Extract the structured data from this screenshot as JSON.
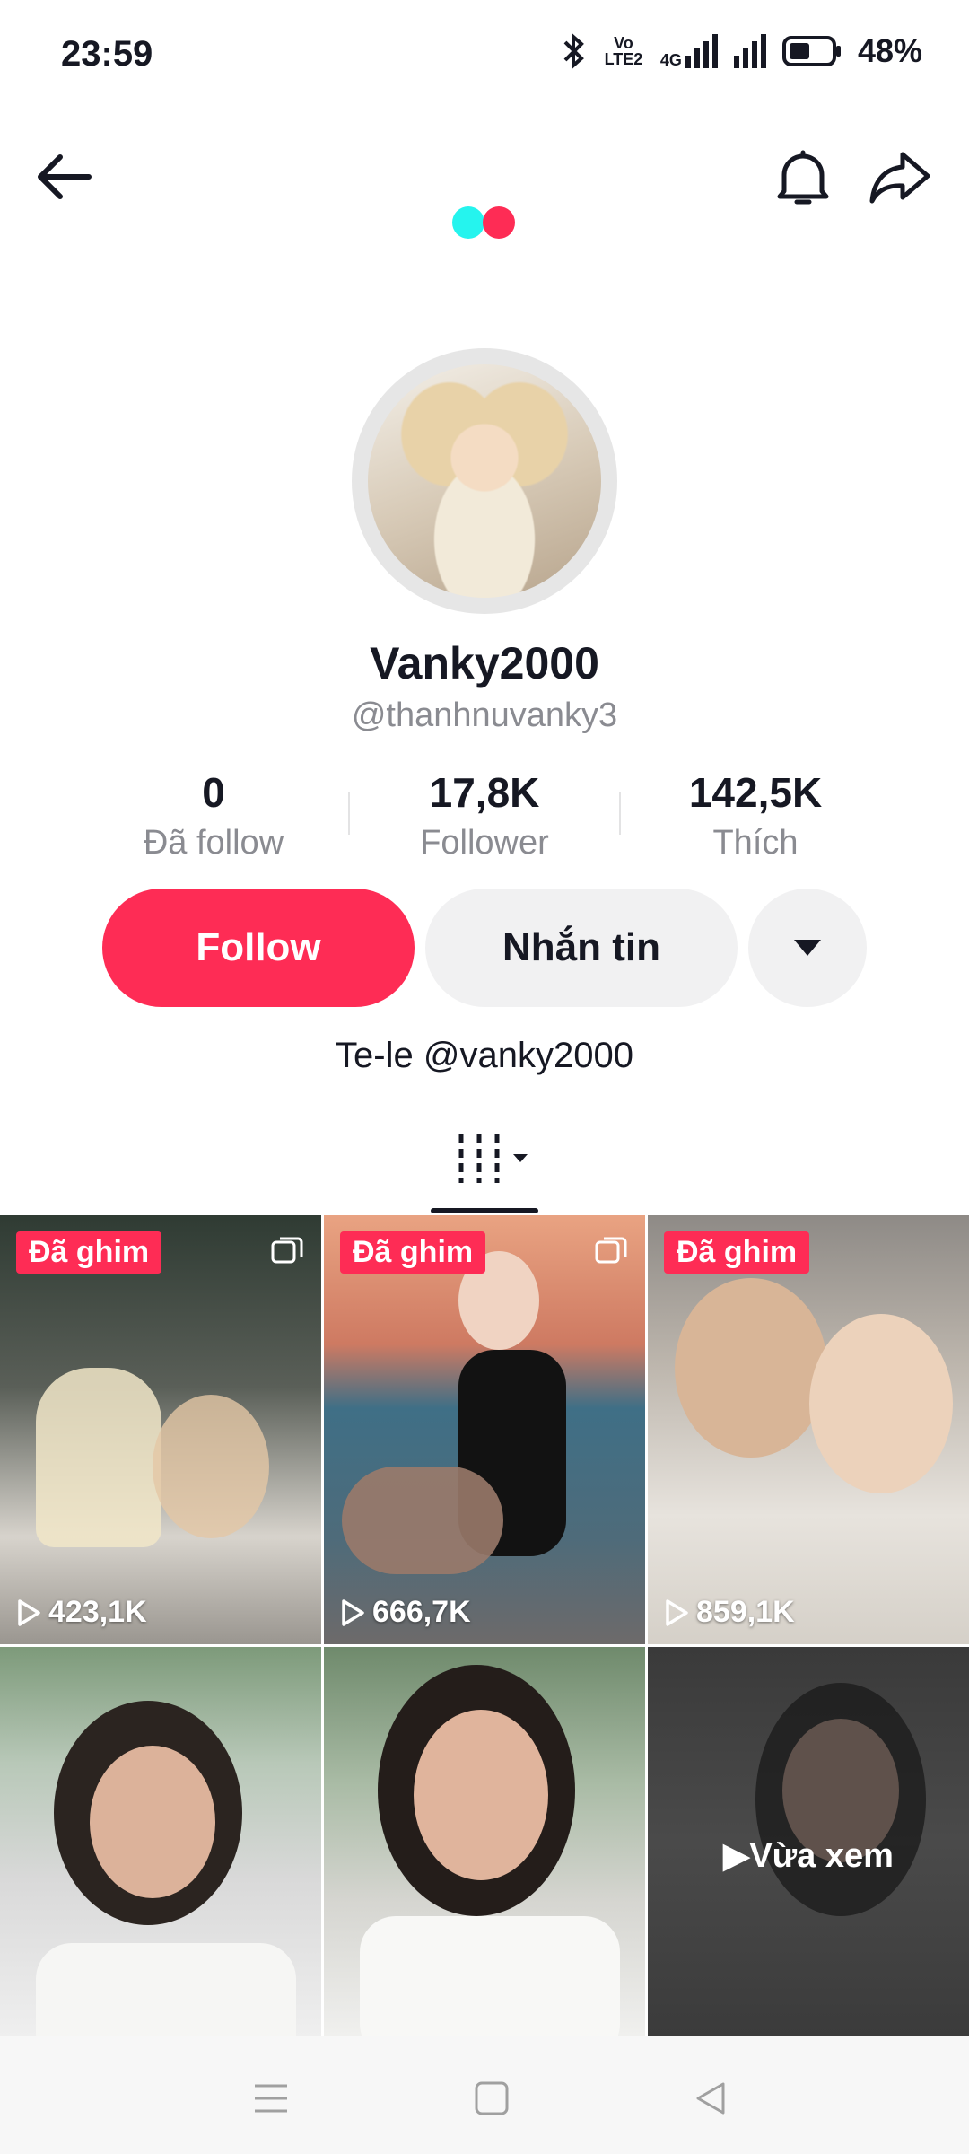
{
  "status_bar": {
    "time": "23:59",
    "network_label": "Vo LTE2",
    "data_label": "4G",
    "battery": "48%"
  },
  "header": {
    "back": "back-arrow-icon",
    "bell": "bell-icon",
    "share": "share-icon"
  },
  "colors": {
    "accent": "#fe2c55",
    "cyan": "#25f4ee",
    "text": "#161823",
    "muted": "#8a8b91"
  },
  "profile": {
    "display_name": "Vanky2000",
    "handle": "@thanhnuvanky3",
    "bio": "Te-le @vanky2000",
    "stats": [
      {
        "value": "0",
        "label": "Đã follow"
      },
      {
        "value": "17,8K",
        "label": "Follower"
      },
      {
        "value": "142,5K",
        "label": "Thích"
      }
    ]
  },
  "actions": {
    "follow": "Follow",
    "message": "Nhắn tin"
  },
  "videos": [
    {
      "pinned": "Đã ghim",
      "views": "423,1K",
      "multi": true
    },
    {
      "pinned": "Đã ghim",
      "views": "666,7K",
      "multi": true
    },
    {
      "pinned": "Đã ghim",
      "views": "859,1K",
      "multi": false
    },
    {
      "views": ""
    },
    {
      "views": ""
    },
    {
      "overlay": "Vừa xem"
    }
  ]
}
